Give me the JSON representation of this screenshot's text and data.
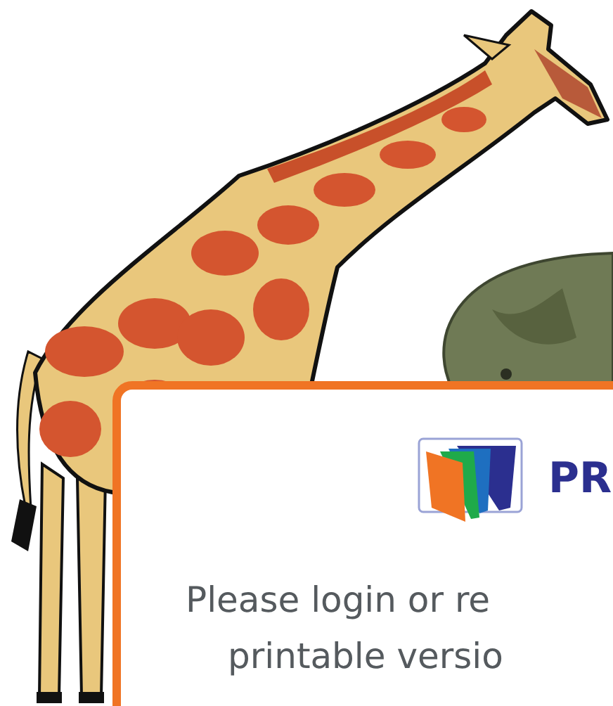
{
  "dialog": {
    "brand": "PR",
    "message_lines": [
      "Please login or re",
      "printable versio"
    ]
  }
}
